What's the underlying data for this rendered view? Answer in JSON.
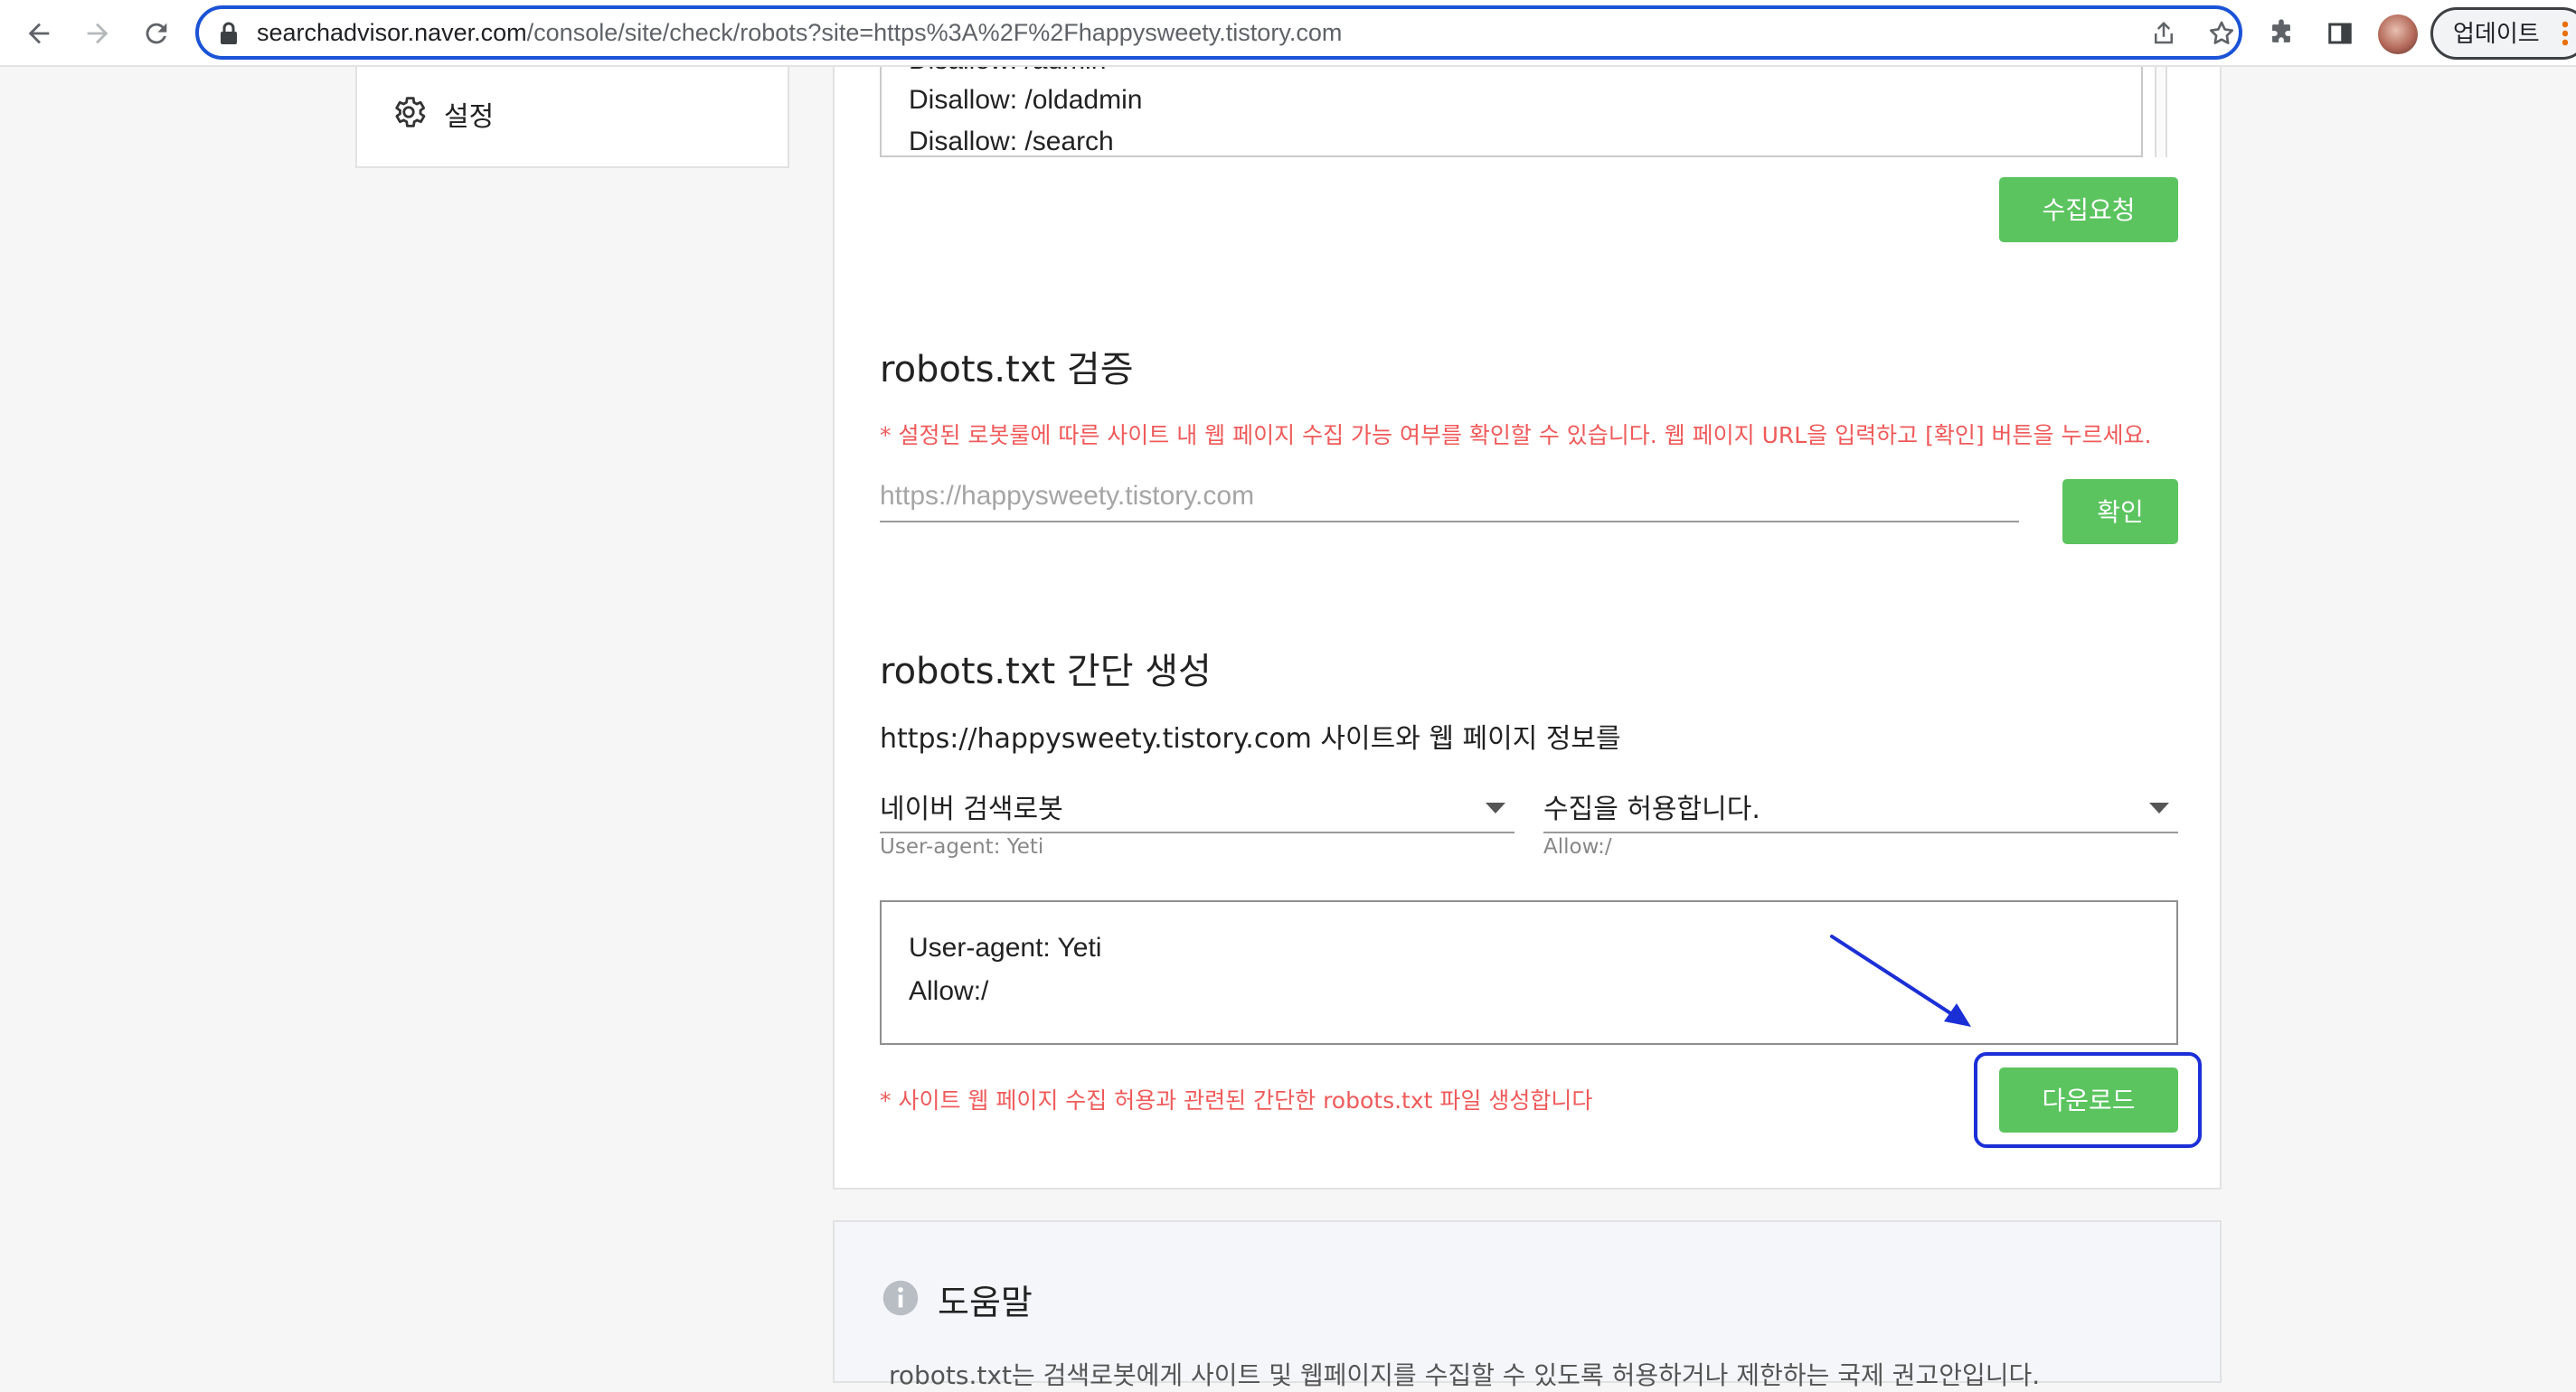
{
  "browser": {
    "url_host": "searchadvisor.naver.com",
    "url_path": "/console/site/check/robots?site=https%3A%2F%2Fhappysweety.tistory.com",
    "update_label": "업데이트"
  },
  "sidebar": {
    "settings_label": "설정"
  },
  "robots_editor": {
    "lines": [
      "Disallow: /admin",
      "Disallow: /oldadmin",
      "Disallow: /search"
    ]
  },
  "collect_request_button": "수집요청",
  "validate": {
    "title": "robots.txt 검증",
    "note": "* 설정된 로봇룰에 따른 사이트 내 웹 페이지 수집 가능 여부를 확인할 수 있습니다. 웹 페이지 URL을 입력하고 [확인] 버튼을 누르세요.",
    "url_placeholder": "https://happysweety.tistory.com",
    "confirm_button": "확인"
  },
  "generator": {
    "title": "robots.txt 간단 생성",
    "description": "https://happysweety.tistory.com 사이트와 웹 페이지 정보를",
    "robot_select": "네이버 검색로봇",
    "robot_sub": "User-agent: Yeti",
    "permission_select": "수집을 허용합니다.",
    "permission_sub": "Allow:/",
    "output_lines": [
      "User-agent: Yeti",
      "Allow:/"
    ],
    "note": "* 사이트 웹 페이지 수집 허용과 관련된 간단한 robots.txt 파일 생성합니다",
    "download_button": "다운로드"
  },
  "help": {
    "title": "도움말",
    "cut_text": "robots.txt는 검색로봇에게 사이트 및 웹페이지를 수집할 수 있도록 허용하거나 제한하는 국제 권고안입니다."
  },
  "colors": {
    "accent_green": "#5bc45f",
    "note_red": "#ef5a5a",
    "annotation_blue": "#1b2fd6"
  }
}
